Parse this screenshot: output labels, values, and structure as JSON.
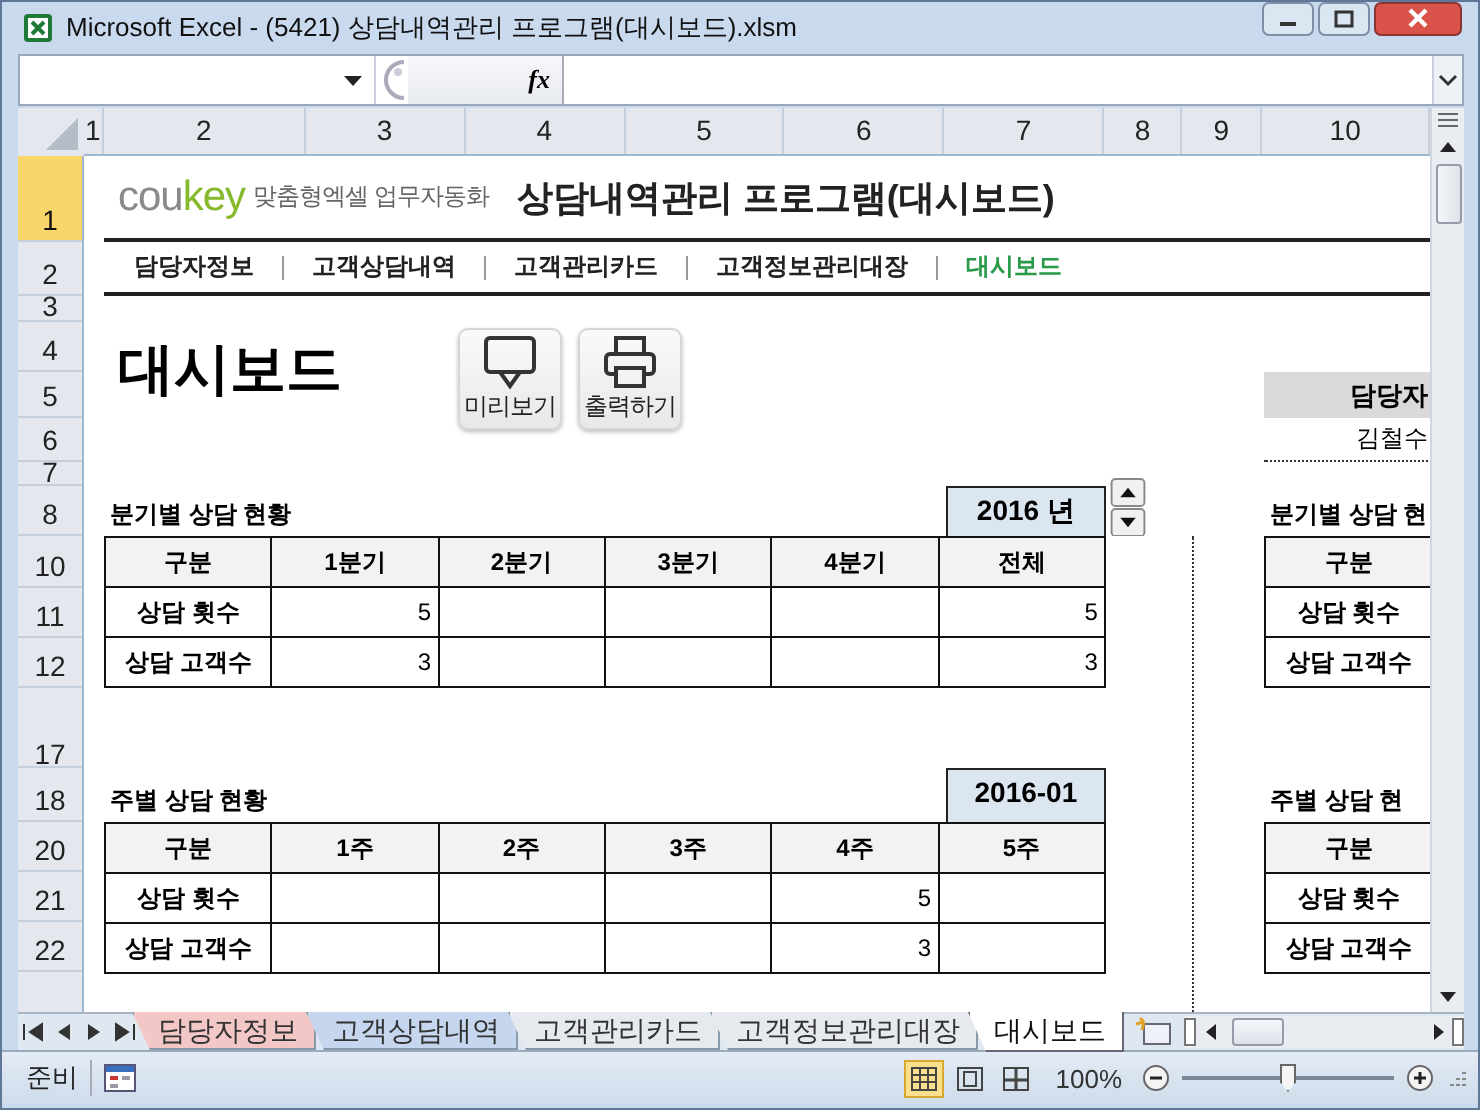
{
  "window": {
    "title": "Microsoft Excel - (5421) 상담내역관리 프로그램(대시보드).xlsm"
  },
  "formula_bar": {
    "function_label": "fx"
  },
  "column_headers": [
    "1",
    "2",
    "3",
    "4",
    "5",
    "6",
    "7",
    "8",
    "9",
    "10"
  ],
  "row_headers": [
    {
      "label": "1",
      "selected": true
    },
    {
      "label": "2",
      "selected": false
    },
    {
      "label": "3",
      "selected": false
    },
    {
      "label": "4",
      "selected": false
    },
    {
      "label": "5",
      "selected": false
    },
    {
      "label": "6",
      "selected": false
    },
    {
      "label": "7",
      "selected": false
    },
    {
      "label": "8",
      "selected": false
    },
    {
      "label": "10",
      "selected": false
    },
    {
      "label": "11",
      "selected": false
    },
    {
      "label": "12",
      "selected": false
    },
    {
      "label": "17",
      "selected": false
    },
    {
      "label": "18",
      "selected": false
    },
    {
      "label": "20",
      "selected": false
    },
    {
      "label": "21",
      "selected": false
    },
    {
      "label": "22",
      "selected": false
    }
  ],
  "brand": {
    "logo_part_1": "cou",
    "logo_part_2": "key",
    "tagline": "맞춤형엑셀 업무자동화",
    "title": "상담내역관리 프로그램(대시보드)"
  },
  "nav": [
    {
      "label": "담당자정보",
      "selected": false
    },
    {
      "label": "고객상담내역",
      "selected": false
    },
    {
      "label": "고객관리카드",
      "selected": false
    },
    {
      "label": "고객정보관리대장",
      "selected": false
    },
    {
      "label": "대시보드",
      "selected": true
    }
  ],
  "page_title": "대시보드",
  "actions": [
    {
      "kind": "monitor",
      "label": "미리보기"
    },
    {
      "kind": "printer",
      "label": "출력하기"
    }
  ],
  "manager": {
    "header": "담당자",
    "name": "김철수"
  },
  "quarterly": {
    "title": "분기별 상담 현황",
    "period": "2016 년",
    "columns": [
      "구분",
      "1분기",
      "2분기",
      "3분기",
      "4분기",
      "전체"
    ],
    "rows": [
      {
        "label": "상담 횟수",
        "cells": [
          "5",
          null,
          null,
          null,
          "5"
        ]
      },
      {
        "label": "상담 고객수",
        "cells": [
          "3",
          null,
          null,
          null,
          "3"
        ]
      }
    ]
  },
  "weekly": {
    "title": "주별 상담 현황",
    "period": "2016-01",
    "columns": [
      "구분",
      "1주",
      "2주",
      "3주",
      "4주",
      "5주"
    ],
    "rows": [
      {
        "label": "상담 횟수",
        "cells": [
          null,
          null,
          null,
          "5",
          null
        ]
      },
      {
        "label": "상담 고객수",
        "cells": [
          null,
          null,
          null,
          "3",
          null
        ]
      }
    ]
  },
  "side_quarterly": {
    "title": "분기별 상담 현",
    "columns": [
      "구분"
    ],
    "rows": [
      "상담 횟수",
      "상담 고객수"
    ]
  },
  "side_weekly": {
    "title": "주별 상담 현",
    "columns": [
      "구분"
    ],
    "rows": [
      "상담 횟수",
      "상담 고객수"
    ]
  },
  "sheet_tabs": [
    {
      "label": "담당자정보",
      "selected": false,
      "color": "#f4c7c7"
    },
    {
      "label": "고객상담내역",
      "selected": false,
      "color": "#c6d6ef"
    },
    {
      "label": "고객관리카드",
      "selected": false,
      "color": "#e6e9ee"
    },
    {
      "label": "고객정보관리대장",
      "selected": false,
      "color": "#e6e9ee"
    },
    {
      "label": "대시보드",
      "selected": true,
      "color": "#ffffff"
    }
  ],
  "status_bar": {
    "mode": "준비",
    "views": [
      {
        "kind": "normal",
        "selected": true
      },
      {
        "kind": "page_layout",
        "selected": false
      },
      {
        "kind": "page_break",
        "selected": false
      }
    ],
    "zoom": "100%",
    "zoom_slider": {
      "level": 0.5
    }
  }
}
